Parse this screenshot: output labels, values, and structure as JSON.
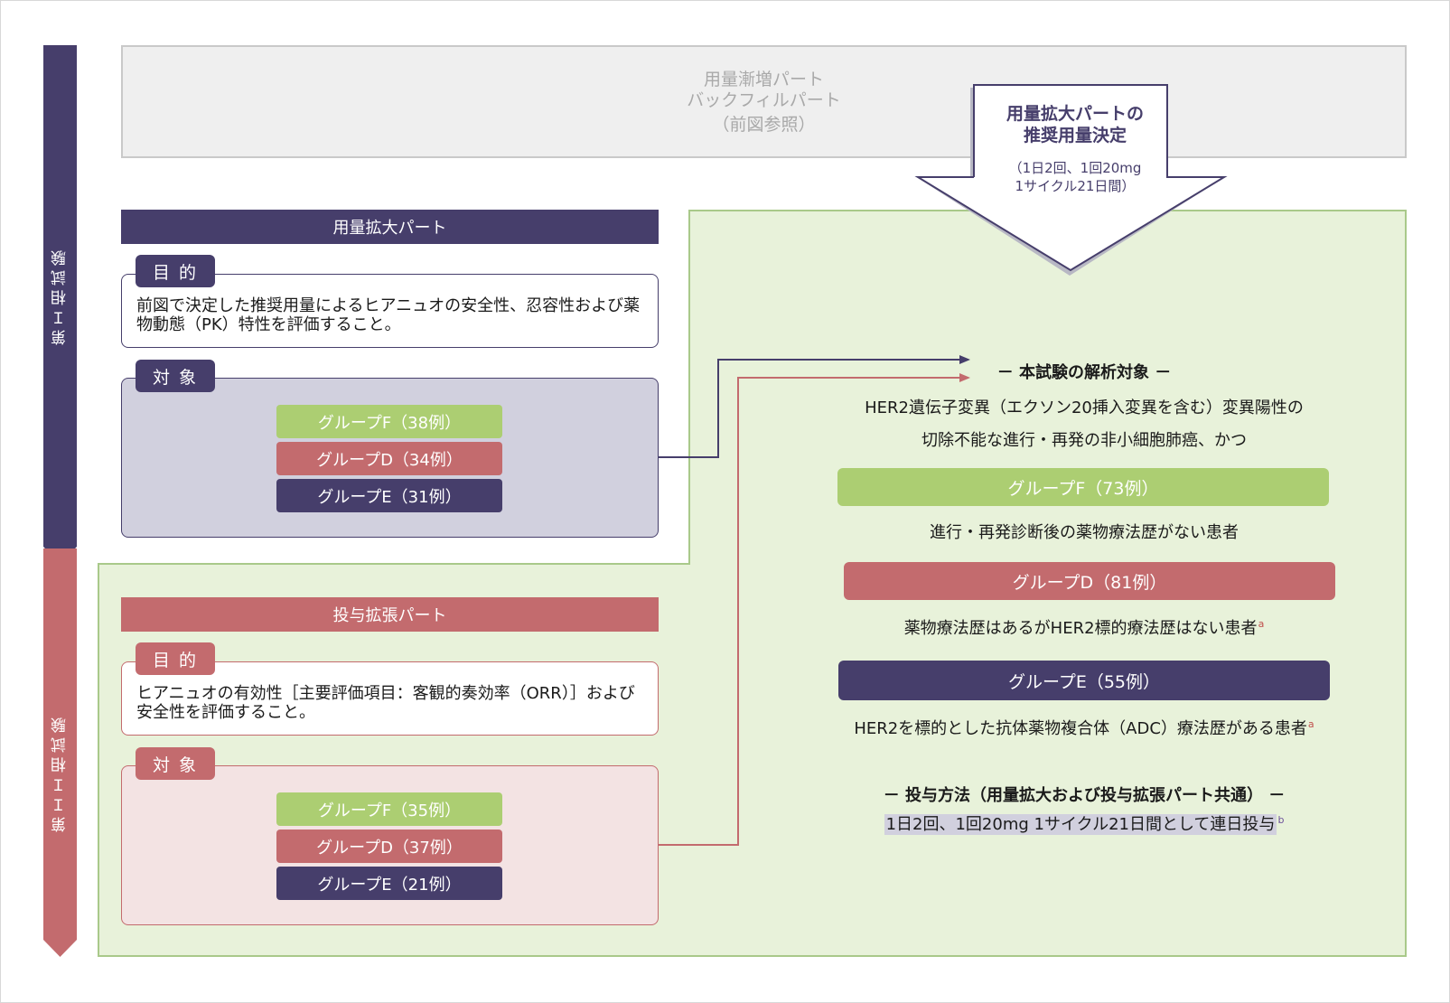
{
  "phases": {
    "phase1": {
      "label": "第Ｉ相試験",
      "color": "#463e6b"
    },
    "phase2": {
      "label": "第ＩＩ相試験",
      "color": "#c36b6e"
    }
  },
  "top_box": {
    "line1": "用量漸増パート",
    "line2": "バックフィルパート",
    "line3": "（前図参照）"
  },
  "arrow": {
    "title_line1": "用量拡大パートの",
    "title_line2": "推奨用量決定",
    "detail_line1": "（1日2回、1回20mg",
    "detail_line2": "1サイクル21日間）"
  },
  "dose_expansion": {
    "header": "用量拡大パート",
    "purpose_tab": "目的",
    "purpose_text": "前図で決定した推奨用量によるヒアニュオの安全性、忍容性および薬物動態（PK）特性を評価すること。",
    "target_tab": "対象",
    "groups": [
      {
        "label": "グループF（38例）"
      },
      {
        "label": "グループD（34例）"
      },
      {
        "label": "グループE（31例）"
      }
    ]
  },
  "dose_extension": {
    "header": "投与拡張パート",
    "purpose_tab": "目的",
    "purpose_text": "ヒアニュオの有効性［主要評価項目：客観的奏効率（ORR）］および安全性を評価すること。",
    "target_tab": "対象",
    "groups": [
      {
        "label": "グループF（35例）"
      },
      {
        "label": "グループD（37例）"
      },
      {
        "label": "グループE（21例）"
      }
    ]
  },
  "analysis": {
    "heading": "－ 本試験の解析対象 －",
    "line1": "HER2遺伝子変異（エクソン20挿入変異を含む）変異陽性の",
    "line2": "切除不能な進行・再発の非小細胞肺癌、かつ",
    "groups": [
      {
        "label": "グループF（73例）",
        "desc": "進行・再発診断後の薬物療法歴がない患者",
        "sup": ""
      },
      {
        "label": "グループD（81例）",
        "desc": "薬物療法歴はあるがHER2標的療法歴はない患者",
        "sup": "a"
      },
      {
        "label": "グループE（55例）",
        "desc": "HER2を標的とした抗体薬物複合体（ADC）療法歴がある患者",
        "sup": "a"
      }
    ],
    "dosing_heading": "－ 投与方法（用量拡大および投与拡張パート共通） －",
    "dosing_text": "1日2回、1回20mg 1サイクル21日間として連日投与",
    "dosing_sup": "b"
  },
  "colors": {
    "navy": "#463e6b",
    "red": "#c36b6e",
    "green": "#acce72",
    "green_bg": "#e8f2da",
    "lavender_bg": "#d1d0de",
    "pink_bg": "#f3e3e3"
  }
}
